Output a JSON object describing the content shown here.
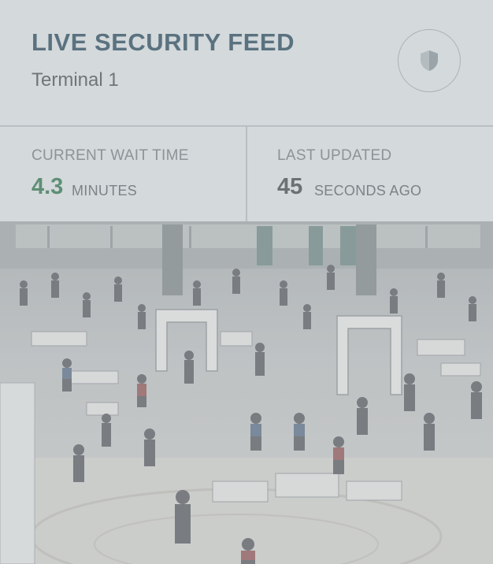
{
  "header": {
    "title": "LIVE SECURITY FEED",
    "subtitle": "Terminal 1",
    "shield_icon": "shield-icon"
  },
  "stats": {
    "wait": {
      "label": "CURRENT WAIT TIME",
      "value": "4.3",
      "unit": "MINUTES",
      "color": "#5e8f76"
    },
    "updated": {
      "label": "LAST UPDATED",
      "value": "45",
      "unit": "SECONDS AGO",
      "color": "#6c7174"
    }
  },
  "feed": {
    "image_kind": "airport-security-checkpoint-camera-feed"
  }
}
